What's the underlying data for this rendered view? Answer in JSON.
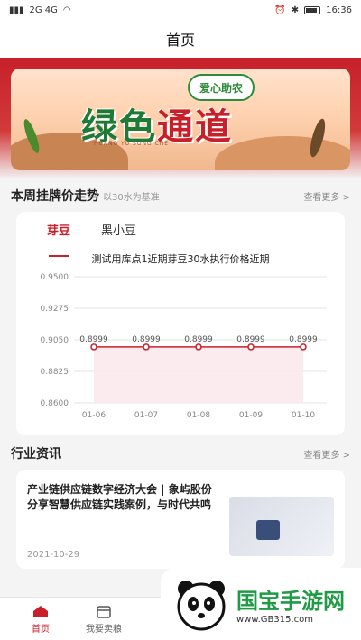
{
  "status_bar": {
    "carrier": "2G 4G",
    "time": "16:36"
  },
  "topbar": {
    "title": "首页"
  },
  "banner": {
    "title_part1": "绿色",
    "title_part2": "通道",
    "badge": "爱心助农",
    "subtitle": "HUANG YU SONG CHE"
  },
  "price_section": {
    "title": "本周挂牌价走势",
    "note": "以30水为基准",
    "more": "查看更多 >"
  },
  "price_card": {
    "tabs": [
      {
        "label": "芽豆",
        "active": true
      },
      {
        "label": "黑小豆",
        "active": false
      }
    ],
    "chart_title": "测试用库点1近期芽豆30水执行价格近期"
  },
  "chart_data": {
    "type": "line",
    "title": "测试用库点1近期芽豆30水执行价格近期",
    "categories": [
      "01-06",
      "01-07",
      "01-08",
      "01-09",
      "01-10"
    ],
    "series": [
      {
        "values": [
          0.8999,
          0.8999,
          0.8999,
          0.8999,
          0.8999
        ]
      }
    ],
    "data_labels": [
      "0.8999",
      "0.8999",
      "0.8999",
      "0.8999",
      "0.8999"
    ],
    "yticks": [
      "0.9500",
      "0.9275",
      "0.9050",
      "0.8825",
      "0.8600"
    ],
    "ylim": [
      0.86,
      0.95
    ],
    "grid": true,
    "line_color": "#c91f2a",
    "area_color": "#fbe9ec"
  },
  "news_section": {
    "title": "行业资讯",
    "more": "查看更多 >"
  },
  "news": [
    {
      "title": "产业链供应链数字经济大会 | 象屿股份分享智慧供应链实践案例，与时代共鸣",
      "date": "2021-10-29"
    }
  ],
  "tabbar": [
    {
      "label": "首页",
      "icon": "home-icon",
      "active": true
    },
    {
      "label": "我要卖粮",
      "icon": "box-icon",
      "active": false
    }
  ],
  "watermark": {
    "name": "国宝手游网",
    "url": "www.GB315.com"
  }
}
